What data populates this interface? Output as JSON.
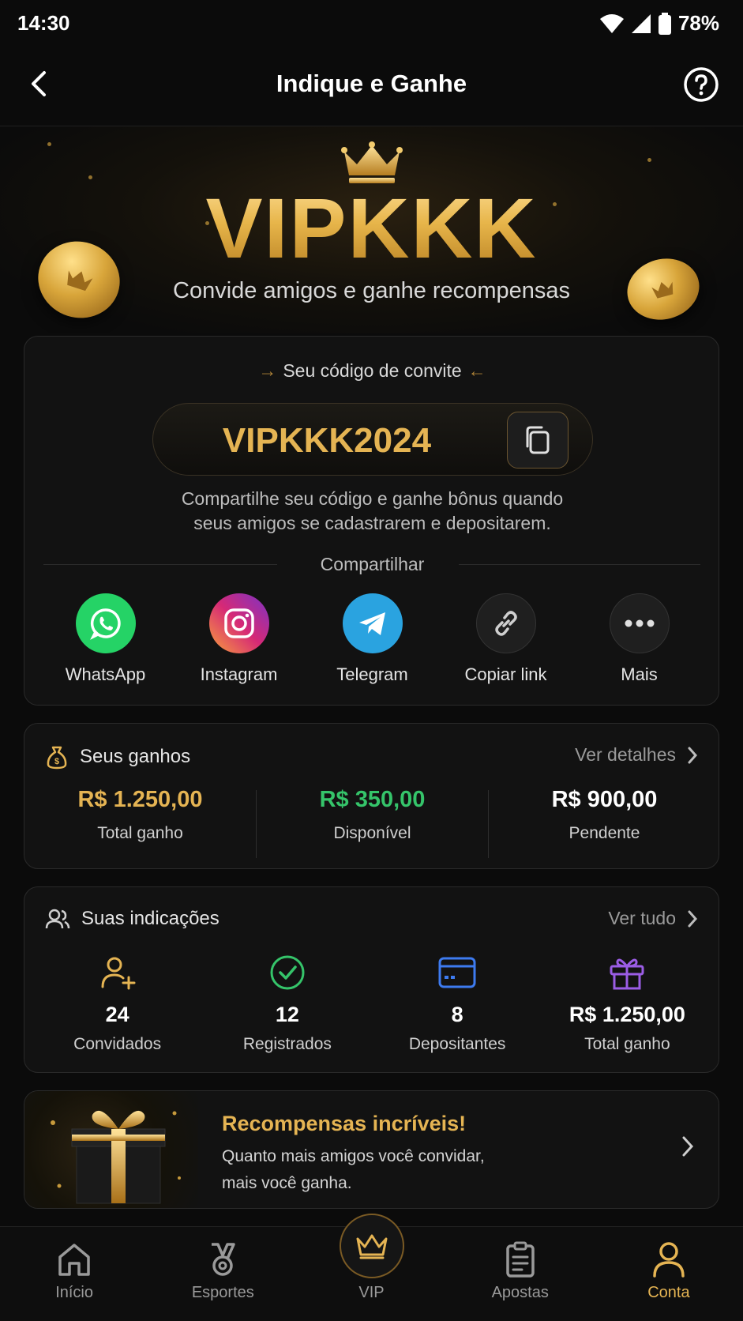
{
  "status_bar": {
    "time": "14:30",
    "battery": "78%"
  },
  "header": {
    "title": "Indique e Ganhe"
  },
  "hero": {
    "brand": "VIPKKK",
    "subtitle": "Convide amigos e ganhe recompensas"
  },
  "invite": {
    "label": "Seu código de convite",
    "code": "VIPKKK2024",
    "description_line1": "Compartilhe seu código e ganhe bônus quando",
    "description_line2": "seus amigos se cadastrarem e depositarem.",
    "share_label": "Compartilhar",
    "share_options": [
      {
        "label": "WhatsApp",
        "icon": "whatsapp-icon",
        "color": "#25d366"
      },
      {
        "label": "Instagram",
        "icon": "instagram-icon",
        "color": "#c13584"
      },
      {
        "label": "Telegram",
        "icon": "telegram-icon",
        "color": "#2aa3e0"
      },
      {
        "label": "Copiar link",
        "icon": "link-icon",
        "color": "#2a2a2a"
      },
      {
        "label": "Mais",
        "icon": "more-icon",
        "color": "#2a2a2a"
      }
    ]
  },
  "earnings": {
    "title": "Seus ganhos",
    "link": "Ver detalhes",
    "stats": [
      {
        "value": "R$ 1.250,00",
        "caption": "Total ganho",
        "color": "#e5b453"
      },
      {
        "value": "R$ 350,00",
        "caption": "Disponível",
        "color": "#35c46a"
      },
      {
        "value": "R$ 900,00",
        "caption": "Pendente",
        "color": "#ffffff"
      }
    ]
  },
  "referrals": {
    "title": "Suas indicações",
    "link": "Ver tudo",
    "stats": [
      {
        "value": "24",
        "caption": "Convidados",
        "icon": "user-plus-icon",
        "color": "#e5b453"
      },
      {
        "value": "12",
        "caption": "Registrados",
        "icon": "check-circle-icon",
        "color": "#35c46a"
      },
      {
        "value": "8",
        "caption": "Depositantes",
        "icon": "card-icon",
        "color": "#3d7bf0"
      },
      {
        "value": "R$ 1.250,00",
        "caption": "Total ganho",
        "icon": "gift-icon",
        "color": "#9b5de5"
      }
    ]
  },
  "banner": {
    "title": "Recompensas incríveis!",
    "text_line1": "Quanto mais amigos você convidar,",
    "text_line2": "mais você ganha."
  },
  "nav": {
    "items": [
      {
        "label": "Início",
        "icon": "home-icon",
        "active": false
      },
      {
        "label": "Esportes",
        "icon": "medal-icon",
        "active": false
      },
      {
        "label": "VIP",
        "icon": "crown-icon",
        "active": false
      },
      {
        "label": "Apostas",
        "icon": "clipboard-icon",
        "active": false
      },
      {
        "label": "Conta",
        "icon": "user-icon",
        "active": true
      }
    ]
  },
  "colors": {
    "accent_gold": "#e5b453",
    "background": "#0b0b0b",
    "card": "#121212"
  }
}
